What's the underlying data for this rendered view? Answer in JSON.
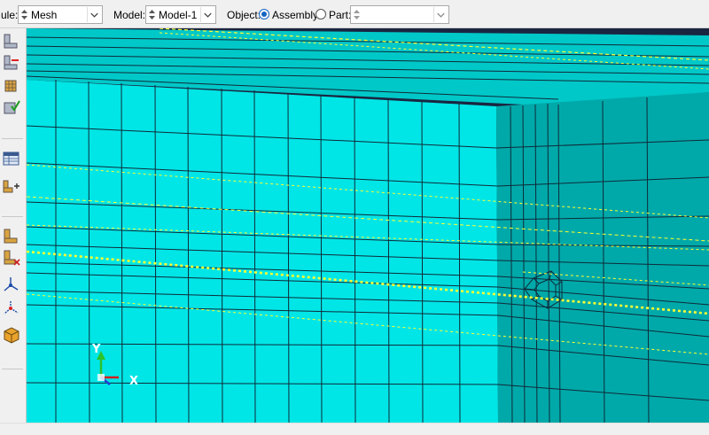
{
  "context_bar": {
    "module_label": "ule:",
    "module_value": "Mesh",
    "model_label": "Model:",
    "model_value": "Model-1",
    "object_label": "Object:",
    "assembly_label": "Assembly",
    "part_label": "Part:",
    "part_value": "",
    "object_selected": "Assembly"
  },
  "toolbox": {
    "icons": [
      "seed-part-instance-icon",
      "seed-edges-icon",
      "assign-mesh-controls-icon",
      "verify-mesh-icon",
      "query-mesh-table-icon",
      "assign-element-type-icon",
      "mesh-part-icon",
      "delete-mesh-icon",
      "datum-csys-icon",
      "datum-axis-icon",
      "partition-cell-icon"
    ]
  },
  "viewport": {
    "triad": {
      "y_label": "Y",
      "x_label": "X"
    },
    "colors": {
      "mesh_front": "#00e6e6",
      "mesh_side": "#00a9a9",
      "mesh_lines": "#0f2a3a",
      "background": "#1a2540",
      "datum_lines": "#ffff33"
    }
  }
}
